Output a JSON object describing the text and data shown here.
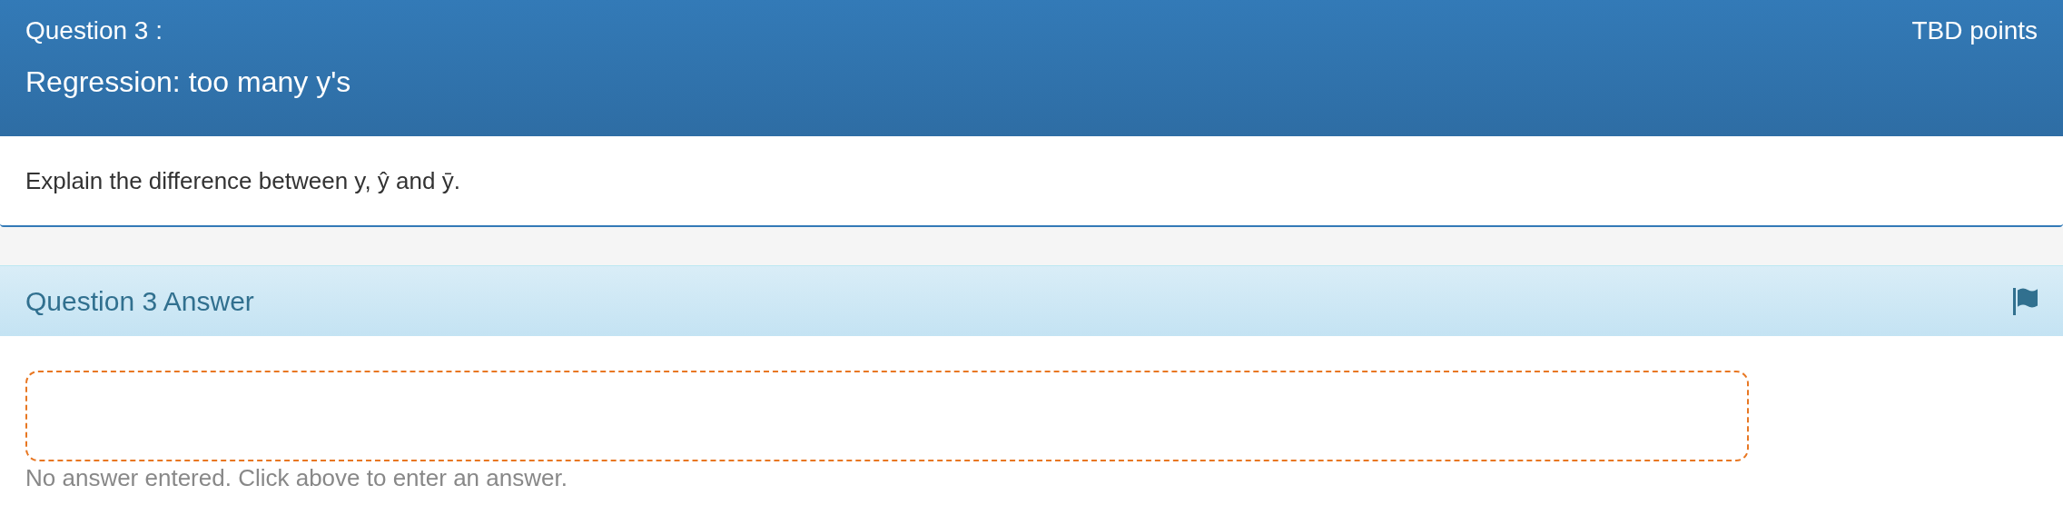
{
  "question": {
    "label": "Question 3 :",
    "points": "TBD points",
    "title": "Regression: too many y's",
    "prompt": "Explain the difference between y, ŷ and ȳ."
  },
  "answer": {
    "heading": "Question 3 Answer",
    "flagged": false,
    "hint": "No answer entered. Click above to enter an answer."
  }
}
